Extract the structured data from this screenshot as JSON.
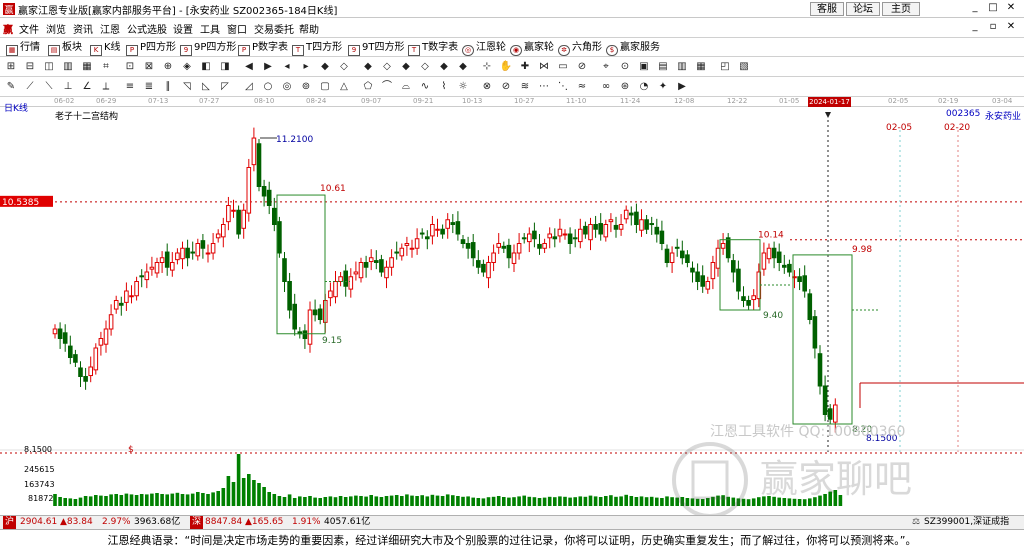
{
  "window": {
    "title": "赢家江恩专业版[赢家内部服务平台] - [永安药业  SZ002365-184日K线]",
    "links": [
      "客服",
      "论坛",
      "主页"
    ]
  },
  "menu": [
    "文件",
    "浏览",
    "资讯",
    "江恩",
    "公式选股",
    "设置",
    "工具",
    "窗口",
    "交易委托",
    "帮助"
  ],
  "nav": [
    "行情",
    "板块",
    "K线",
    "P四方形",
    "9P四方形",
    "P数字表",
    "T四方形",
    "9T四方形",
    "T数字表",
    "江恩轮",
    "赢家轮",
    "六角形",
    "赢家服务"
  ],
  "timeaxis": {
    "dates": [
      "06-02",
      "06-29",
      "07-13",
      "07-27",
      "08-10",
      "08-24",
      "09-07",
      "09-21",
      "10-13",
      "10-27",
      "11-10",
      "11-24",
      "12-08",
      "12-22",
      "01-05",
      "02-05",
      "02-19",
      "03-04"
    ],
    "current": "2024-01-17"
  },
  "chart": {
    "period_label": "日K线",
    "structure_label": "老子十二宫结构",
    "stock_code": "002365",
    "stock_name": "永安药业",
    "price_tag": "10.5385",
    "future_dates": [
      "02-05",
      "02-20"
    ],
    "annotations": {
      "high": "11.2100",
      "box1_top": "10.61",
      "box1_bottom": "9.15",
      "box2_top": "10.14",
      "box2_bottom": "9.40",
      "box3_top": "9.98",
      "box3_bottom": "8.20",
      "low": "8.1500"
    },
    "watermark_text": "江恩工具软件 QQ:100800360",
    "logo_text": "赢家聊吧"
  },
  "volume": {
    "labels": [
      "8.1500",
      "245615",
      "163743",
      "81872"
    ],
    "marker": "$"
  },
  "status": {
    "sh_index": "2904.61",
    "sh_change": "▲83.84",
    "sh_pct": "2.97%",
    "sh_amount": "3963.68亿",
    "sz_index": "8847.84",
    "sz_change": "▲165.65",
    "sz_pct": "1.91%",
    "sz_amount": "4057.61亿",
    "right": "SZ399001,深证成指"
  },
  "quote": "江恩经典语录：“时间是决定市场走势的重要因素，经过详细研究大市及个别股票的过往记录，你将可以证明，历史确实重复发生；而了解过往，你将可以预测将来。”。",
  "chart_data": {
    "type": "candlestick",
    "ylim": [
      8.0,
      11.4
    ],
    "price_levels": [
      11.21,
      10.61,
      10.5385,
      10.14,
      9.98,
      9.4,
      9.15,
      8.2,
      8.15
    ],
    "series": [
      {
        "name": "K线",
        "close": [
          9.2,
          9.1,
          9.05,
          8.9,
          8.85,
          8.7,
          8.65,
          8.8,
          9.0,
          9.1,
          9.2,
          9.35,
          9.5,
          9.45,
          9.6,
          9.55,
          9.7,
          9.75,
          9.8,
          9.85,
          9.9,
          9.95,
          9.85,
          9.9,
          10.0,
          10.05,
          9.95,
          10.0,
          10.1,
          10.05,
          10.0,
          10.1,
          10.2,
          10.3,
          10.5,
          10.45,
          10.2,
          10.45,
          10.9,
          11.21,
          10.7,
          10.6,
          10.5,
          10.3,
          10.0,
          9.7,
          9.4,
          9.2,
          9.15,
          9.1,
          9.4,
          9.35,
          9.3,
          9.5,
          9.6,
          9.7,
          9.75,
          9.65,
          9.75,
          9.8,
          9.9,
          9.85,
          9.95,
          9.9,
          9.8,
          9.85,
          9.95,
          10.0,
          10.05,
          10.1,
          10.05,
          10.15,
          10.2,
          10.15,
          10.3,
          10.25,
          10.2,
          10.35,
          10.3,
          10.2,
          10.1,
          10.05,
          9.95,
          9.85,
          9.8,
          9.9,
          10.0,
          10.1,
          10.05,
          9.95,
          10.0,
          10.1,
          10.15,
          10.2,
          10.15,
          10.05,
          10.1,
          10.2,
          10.15,
          10.25,
          10.2,
          10.1,
          10.15,
          10.25,
          10.2,
          10.3,
          10.25,
          10.2,
          10.3,
          10.35,
          10.25,
          10.3,
          10.45,
          10.4,
          10.3,
          10.35,
          10.25,
          10.3,
          10.2,
          10.1,
          9.9,
          10.0,
          10.05,
          9.95,
          9.9,
          9.8,
          9.7,
          9.65,
          9.7,
          9.9,
          10.05,
          10.1,
          9.95,
          9.8,
          9.6,
          9.5,
          9.45,
          9.55,
          9.8,
          10.0,
          10.05,
          9.95,
          9.9,
          9.85,
          9.8,
          9.75,
          9.7,
          9.6,
          9.3,
          9.0,
          8.6,
          8.3,
          8.25,
          8.4
        ],
        "volume": [
          60,
          45,
          40,
          38,
          35,
          42,
          50,
          48,
          55,
          52,
          50,
          58,
          60,
          55,
          62,
          58,
          55,
          60,
          58,
          62,
          65,
          60,
          58,
          62,
          66,
          60,
          58,
          62,
          70,
          65,
          60,
          68,
          75,
          90,
          150,
          120,
          260,
          140,
          160,
          130,
          115,
          95,
          70,
          60,
          50,
          45,
          58,
          40,
          48,
          45,
          50,
          42,
          40,
          45,
          48,
          44,
          50,
          45,
          48,
          52,
          50,
          47,
          55,
          48,
          45,
          50,
          52,
          55,
          50,
          58,
          52,
          50,
          54,
          48,
          56,
          52,
          50,
          58,
          54,
          50,
          46,
          48,
          42,
          40,
          38,
          44,
          46,
          50,
          45,
          42,
          44,
          48,
          52,
          46,
          44,
          40,
          42,
          46,
          44,
          48,
          46,
          42,
          44,
          48,
          46,
          52,
          48,
          45,
          50,
          54,
          46,
          48,
          56,
          50,
          45,
          48,
          44,
          46,
          42,
          40,
          48,
          44,
          42,
          45,
          40,
          38,
          36,
          35,
          40,
          46,
          52,
          54,
          46,
          42,
          38,
          36,
          34,
          38,
          44,
          48,
          50,
          46,
          42,
          40,
          38,
          36,
          35,
          34,
          38,
          44,
          52,
          60,
          72,
          80,
          55
        ]
      }
    ]
  }
}
